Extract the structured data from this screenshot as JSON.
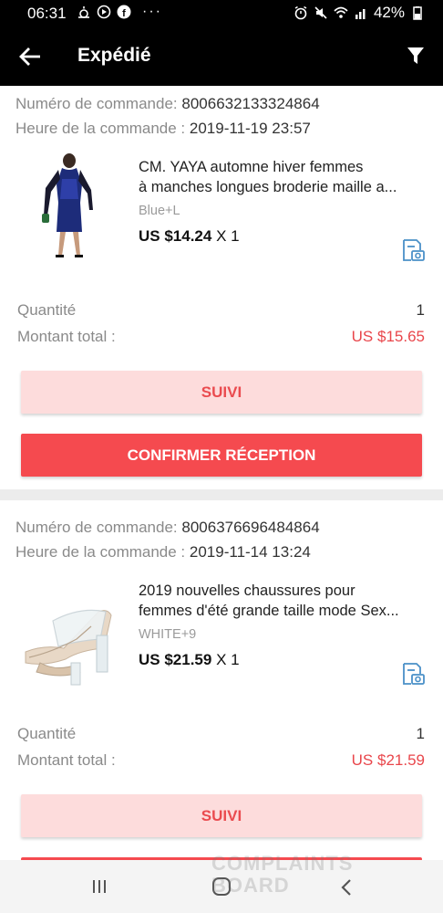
{
  "status_bar": {
    "time": "06:31",
    "battery": "42%"
  },
  "app_bar": {
    "title": "Expédié"
  },
  "orders": [
    {
      "order_number_label": "Numéro de commande:",
      "order_number": "8006632133324864",
      "order_time_label": "Heure de la commande :",
      "order_time": "2019-11-19 23:57",
      "product_line1": "CM. YAYA automne hiver femmes",
      "product_line2": "à manches longues broderie maille a...",
      "variant": "Blue+L",
      "price": "US $14.24",
      "qty_mult": " X 1",
      "quantity_label": "Quantité",
      "quantity": "1",
      "total_label": "Montant total :",
      "total": "US $15.65",
      "track_button": "SUIVI",
      "confirm_button": "CONFIRMER RÉCEPTION"
    },
    {
      "order_number_label": "Numéro de commande:",
      "order_number": "8006376696484864",
      "order_time_label": "Heure de la commande :",
      "order_time": "2019-11-14 13:24",
      "product_line1": "2019 nouvelles chaussures pour",
      "product_line2": "femmes d'été grande taille mode Sex...",
      "variant": "WHITE+9",
      "price": "US $21.59",
      "qty_mult": " X 1",
      "quantity_label": "Quantité",
      "quantity": "1",
      "total_label": "Montant total :",
      "total": "US $21.59",
      "track_button": "SUIVI"
    }
  ],
  "watermark": {
    "line1": "COMPLAINTS",
    "line2": "BOARD"
  },
  "colors": {
    "accent": "#f54a4f",
    "accent_light": "#fddcdc",
    "price_red": "#e9464b",
    "header": "#000000"
  }
}
